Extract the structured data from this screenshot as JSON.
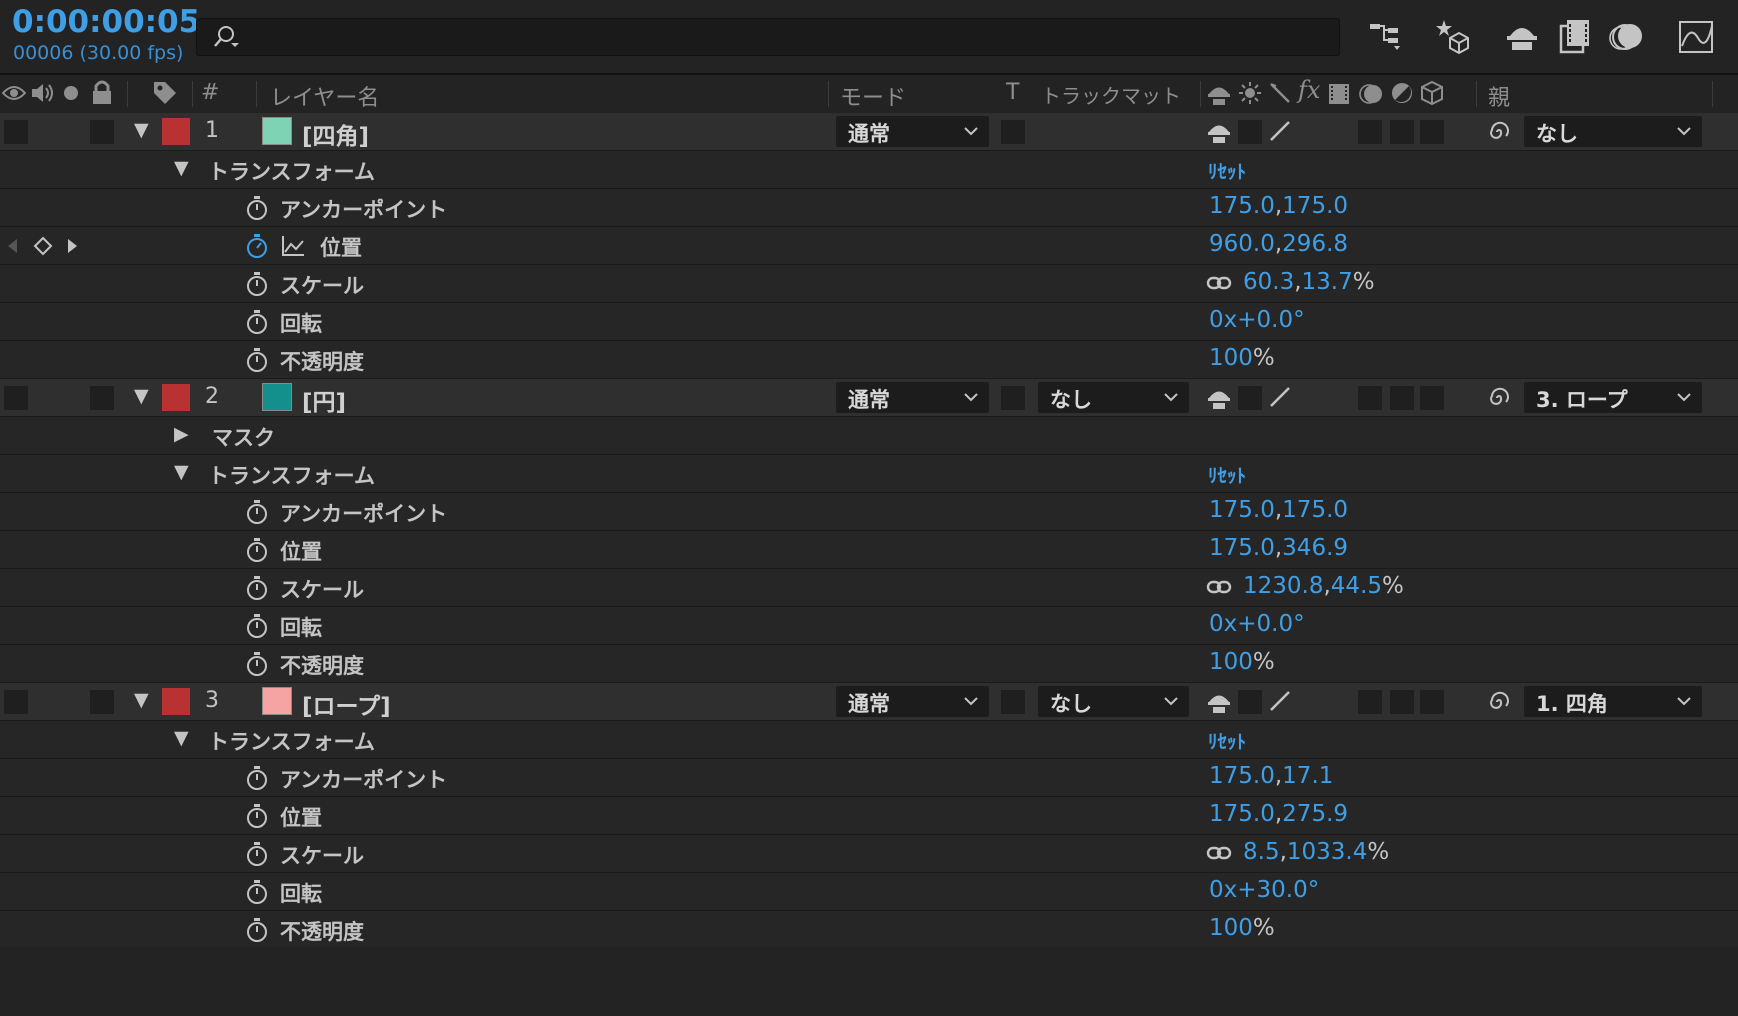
{
  "header": {
    "timecode": "0:00:00:05",
    "frame_fps": "00006 (30.00 fps)",
    "search_placeholder": ""
  },
  "columns": {
    "number": "#",
    "layer_name": "レイヤー名",
    "mode": "モード",
    "t": "T",
    "track_matte": "トラックマット",
    "parent": "親"
  },
  "icons": [
    "eye-icon",
    "speaker-icon",
    "solo-dot-icon",
    "lock-icon",
    "label-tag-icon",
    "flowchart-icon",
    "draft3d-icon",
    "shy-icon",
    "frame-blend-icon",
    "motion-blur-icon",
    "graph-editor-icon",
    "stopwatch-icon",
    "chain-link-icon",
    "pick-whip-icon",
    "chevron-down-icon",
    "keyframe-diamond-icon"
  ],
  "colors": {
    "accent": "#3f9fe6",
    "label_red": "#b83232"
  },
  "layers": [
    {
      "number": "1",
      "name": "[四角]",
      "source_color": "#7fd3b5",
      "mode": "通常",
      "track_matte": "",
      "parent": "なし",
      "transform_label": "トランスフォーム",
      "reset_label": "ﾘｾｯﾄ",
      "props": [
        {
          "name": "アンカーポイント",
          "v1": "175.0",
          "sep": ",",
          "v2": "175.0",
          "suffix": ""
        },
        {
          "name": "位置",
          "v1": "960.0",
          "sep": ",",
          "v2": "296.8",
          "suffix": ""
        },
        {
          "name": "スケール",
          "v1": "60.3",
          "sep": ",",
          "v2": "13.7",
          "suffix": "%"
        },
        {
          "name": "回転",
          "v1": "0x+0.0°",
          "sep": "",
          "v2": "",
          "suffix": ""
        },
        {
          "name": "不透明度",
          "v1": "100",
          "sep": "",
          "v2": "",
          "suffix": "%"
        }
      ]
    },
    {
      "number": "2",
      "name": "[円]",
      "source_color": "#13908c",
      "mode": "通常",
      "track_matte": "なし",
      "parent": "3. ロープ",
      "mask_label": "マスク",
      "transform_label": "トランスフォーム",
      "reset_label": "ﾘｾｯﾄ",
      "props": [
        {
          "name": "アンカーポイント",
          "v1": "175.0",
          "sep": ",",
          "v2": "175.0",
          "suffix": ""
        },
        {
          "name": "位置",
          "v1": "175.0",
          "sep": ",",
          "v2": "346.9",
          "suffix": ""
        },
        {
          "name": "スケール",
          "v1": "1230.8",
          "sep": ",",
          "v2": "44.5",
          "suffix": "%"
        },
        {
          "name": "回転",
          "v1": "0x+0.0°",
          "sep": "",
          "v2": "",
          "suffix": ""
        },
        {
          "name": "不透明度",
          "v1": "100",
          "sep": "",
          "v2": "",
          "suffix": "%"
        }
      ]
    },
    {
      "number": "3",
      "name": "[ロープ]",
      "source_color": "#f6a3a3",
      "mode": "通常",
      "track_matte": "なし",
      "parent": "1. 四角",
      "transform_label": "トランスフォーム",
      "reset_label": "ﾘｾｯﾄ",
      "props": [
        {
          "name": "アンカーポイント",
          "v1": "175.0",
          "sep": ",",
          "v2": "17.1",
          "suffix": ""
        },
        {
          "name": "位置",
          "v1": "175.0",
          "sep": ",",
          "v2": "275.9",
          "suffix": ""
        },
        {
          "name": "スケール",
          "v1": "8.5",
          "sep": ",",
          "v2": "1033.4",
          "suffix": "%"
        },
        {
          "name": "回転",
          "v1": "0x+30.0°",
          "sep": "",
          "v2": "",
          "suffix": ""
        },
        {
          "name": "不透明度",
          "v1": "100",
          "sep": "",
          "v2": "",
          "suffix": "%"
        }
      ]
    }
  ]
}
